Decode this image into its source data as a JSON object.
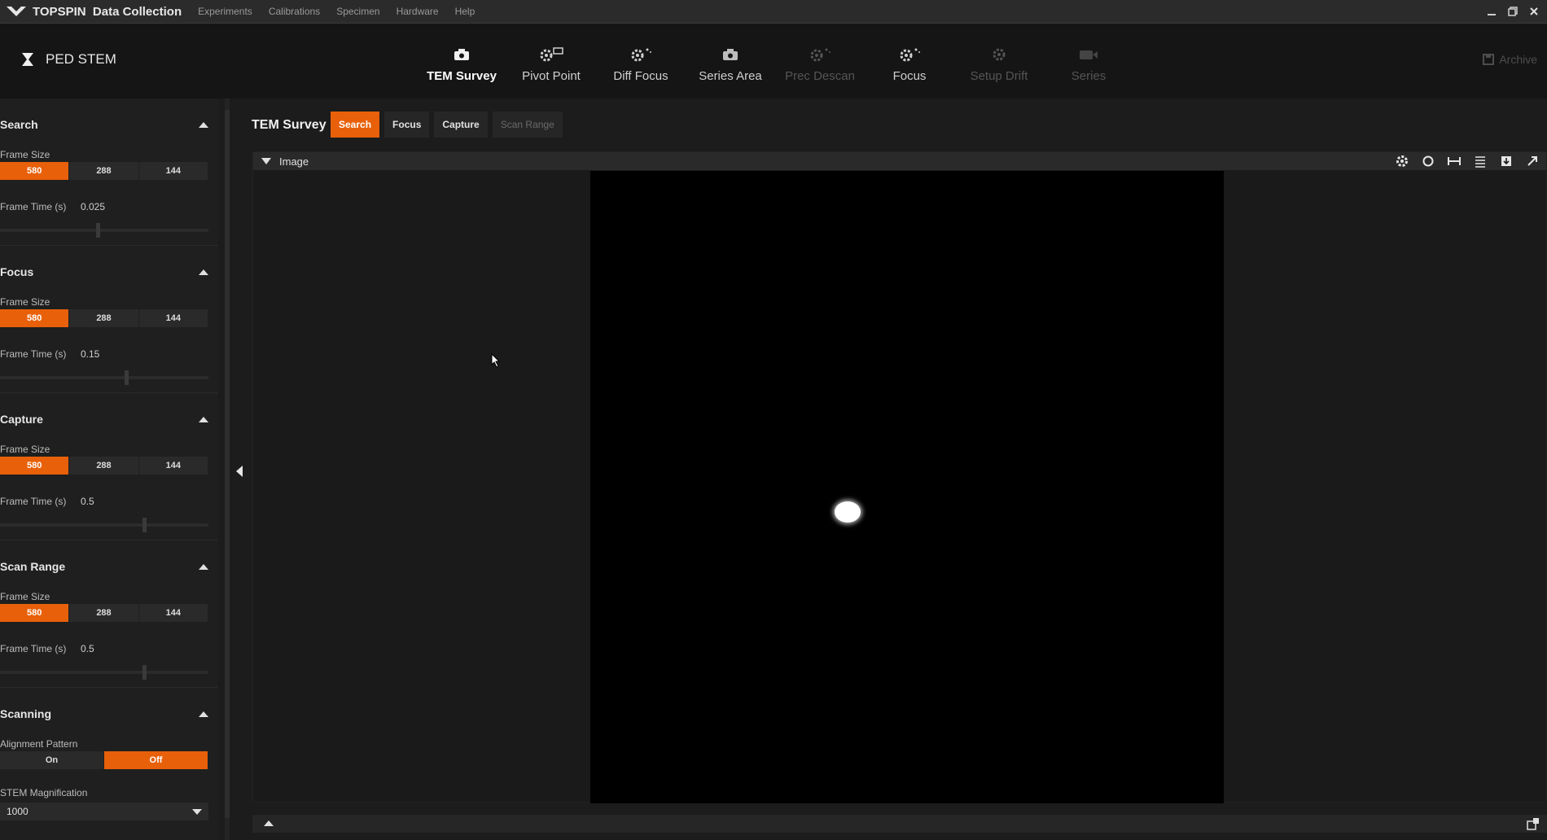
{
  "app": {
    "brand": "TOPSPIN",
    "title": "Data Collection",
    "menu": [
      "Experiments",
      "Calibrations",
      "Specimen",
      "Hardware",
      "Help"
    ]
  },
  "header": {
    "mode": "PED STEM",
    "workflow": [
      {
        "label": "TEM Survey",
        "state": "active",
        "icon": "camera-icon"
      },
      {
        "label": "Pivot Point",
        "state": "normal",
        "icon": "gear-window-icon"
      },
      {
        "label": "Diff Focus",
        "state": "normal",
        "icon": "gear-sparkle-icon"
      },
      {
        "label": "Series Area",
        "state": "normal",
        "icon": "camera-icon"
      },
      {
        "label": "Prec Descan",
        "state": "disabled",
        "icon": "gear-sparkle-icon"
      },
      {
        "label": "Focus",
        "state": "normal",
        "icon": "gear-sparkle-icon"
      },
      {
        "label": "Setup Drift",
        "state": "disabled",
        "icon": "gear-icon"
      },
      {
        "label": "Series",
        "state": "disabled",
        "icon": "video-icon"
      }
    ],
    "archive": "Archive"
  },
  "sidebar": {
    "frame_size_label": "Frame Size",
    "frame_time_label": "Frame Time (s)",
    "frame_sizes": [
      "580",
      "288",
      "144"
    ],
    "sections": [
      {
        "title": "Search",
        "selected": "580",
        "frame_time": "0.025",
        "slider": 0.4
      },
      {
        "title": "Focus",
        "selected": "580",
        "frame_time": "0.15",
        "slider": 0.5
      },
      {
        "title": "Capture",
        "selected": "580",
        "frame_time": "0.5",
        "slider": 0.57
      },
      {
        "title": "Scan Range",
        "selected": "580",
        "frame_time": "0.5",
        "slider": 0.57
      }
    ],
    "scanning": {
      "title": "Scanning",
      "alignment_label": "Alignment Pattern",
      "on": "On",
      "off": "Off",
      "selected": "Off",
      "mag_label": "STEM Magnification",
      "mag_value": "1000"
    }
  },
  "main": {
    "title": "TEM Survey",
    "tabs": [
      {
        "label": "Search",
        "state": "active"
      },
      {
        "label": "Focus",
        "state": "normal"
      },
      {
        "label": "Capture",
        "state": "normal"
      },
      {
        "label": "Scan Range",
        "state": "disabled"
      }
    ],
    "panel_title": "Image"
  },
  "colors": {
    "accent": "#e8600a",
    "background": "#1c1c1c",
    "image_bg": "#000000"
  }
}
